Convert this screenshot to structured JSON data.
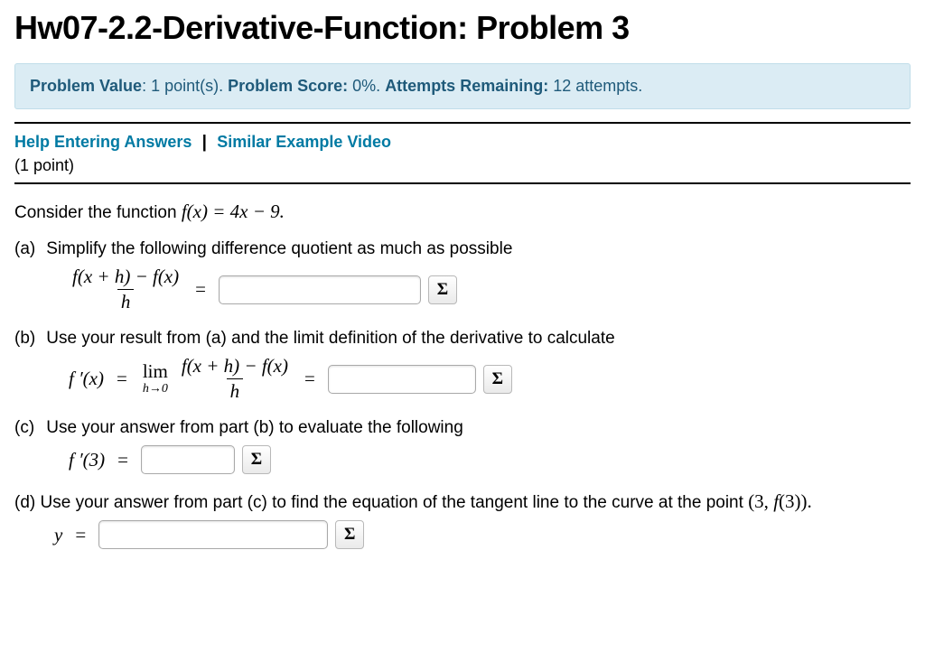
{
  "title": "Hw07-2.2-Derivative-Function: Problem 3",
  "status": {
    "value_label": "Problem Value",
    "value_text": ": 1 point(s). ",
    "score_label": "Problem Score:",
    "score_text": " 0%. ",
    "attempts_label": "Attempts Remaining:",
    "attempts_text": " 12 attempts."
  },
  "help": {
    "link1": "Help Entering Answers",
    "sep": "|",
    "link2": "Similar Example Video",
    "points": "(1 point)"
  },
  "intro_prefix": "Consider the function ",
  "intro_math": "f(x) = 4x − 9.",
  "parts": {
    "a": {
      "label": "(a)",
      "text": "Simplify the following difference quotient as much as possible"
    },
    "b": {
      "label": "(b)",
      "text": "Use your result from (a) and the limit definition of the derivative to calculate"
    },
    "c": {
      "label": "(c)",
      "text": "Use your answer from part (b) to evaluate the following"
    },
    "d": {
      "label": "(d)",
      "text": "Use your answer from part (c) to find the equation of the tangent line to the curve at the point ",
      "math": "(3, f(3))."
    }
  },
  "math": {
    "diffquot_num": "f(x + h) − f(x)",
    "diffquot_den": "h",
    "eq": "=",
    "fprimex": "f ′(x)",
    "limword": "lim",
    "limsub": "h→0",
    "fprime3": "f ′(3)",
    "y": "y"
  },
  "sigma": "Σ"
}
